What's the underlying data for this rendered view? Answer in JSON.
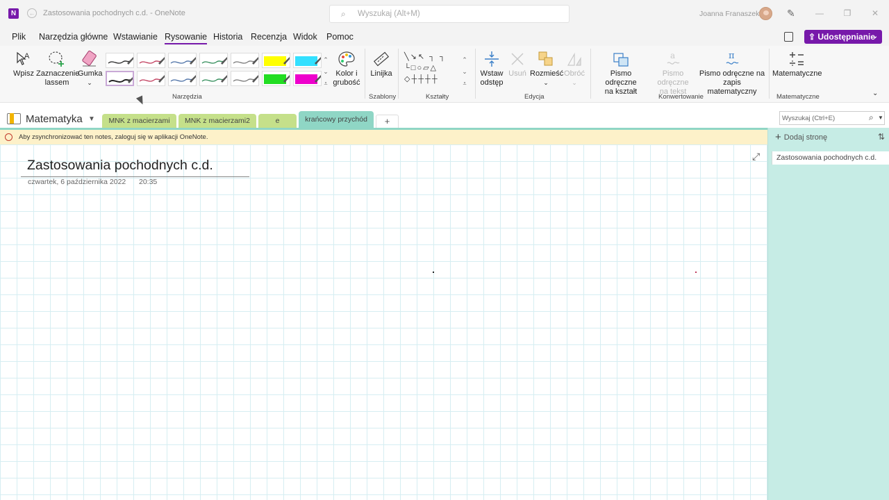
{
  "titlebar": {
    "doc_title": "Zastosowania pochodnych c.d.  -  OneNote",
    "search_placeholder": "Wyszukaj (Alt+M)",
    "user_name": "Joanna Franaszek",
    "app_icon": "N"
  },
  "menu": {
    "items": [
      "Plik",
      "Narzędzia główne",
      "Wstawianie",
      "Rysowanie",
      "Historia",
      "Recenzja",
      "Widok",
      "Pomoc"
    ],
    "active": "Rysowanie",
    "share_label": "Udostępnianie"
  },
  "ribbon": {
    "tools": {
      "wpisz": "Wpisz",
      "lasso_l1": "Zaznaczenie",
      "lasso_l2": "lassem",
      "eraser": "Gumka",
      "color_l1": "Kolor i",
      "color_l2": "grubość",
      "group": "Narzędzia"
    },
    "pen_colors": [
      "#222222",
      "#c0395a",
      "#4a6fa5",
      "#2e8b57",
      "#777777",
      "#ffff00",
      "#33e0ff",
      "#222222",
      "#c0395a",
      "#4a6fa5",
      "#2e8b57",
      "#777777",
      "#22dd22",
      "#ee00cc"
    ],
    "templates": {
      "ruler": "Linijka",
      "group": "Szablony"
    },
    "shapes": {
      "group": "Kształty"
    },
    "editing": {
      "insert_space_l1": "Wstaw",
      "insert_space_l2": "odstęp",
      "delete": "Usuń",
      "arrange": "Rozmieść",
      "rotate": "Obróć",
      "group": "Edycja"
    },
    "convert": {
      "ink_shape_l1": "Pismo odręczne",
      "ink_shape_l2": "na kształt",
      "ink_text_l1": "Pismo odręczne",
      "ink_text_l2": "na tekst",
      "ink_math_l1": "Pismo odręczne na",
      "ink_math_l2": "zapis matematyczny",
      "group": "Konwertowanie"
    },
    "math": {
      "label": "Matematyczne",
      "group": "Matematyczne"
    }
  },
  "notebook": {
    "name": "Matematyka",
    "sections": [
      {
        "label": "MNK z macierzami",
        "color": "#c5e08a"
      },
      {
        "label": "MNK z macierzami2",
        "color": "#c5e08a"
      },
      {
        "label": "e",
        "color": "#c5e08a"
      },
      {
        "label": "krańcowy przychód",
        "color": "#8fd6c5"
      }
    ],
    "add_section": "+",
    "search_placeholder": "Wyszukaj (Ctrl+E)"
  },
  "notice": {
    "text": "Aby zsynchronizować ten notes, zaloguj się w aplikacji OneNote."
  },
  "page": {
    "title": "Zastosowania pochodnych c.d.",
    "date": "czwartek, 6 października 2022",
    "time": "20:35"
  },
  "pages_pane": {
    "add_page": "Dodaj stronę",
    "pages": [
      "Zastosowania pochodnych c.d."
    ]
  }
}
